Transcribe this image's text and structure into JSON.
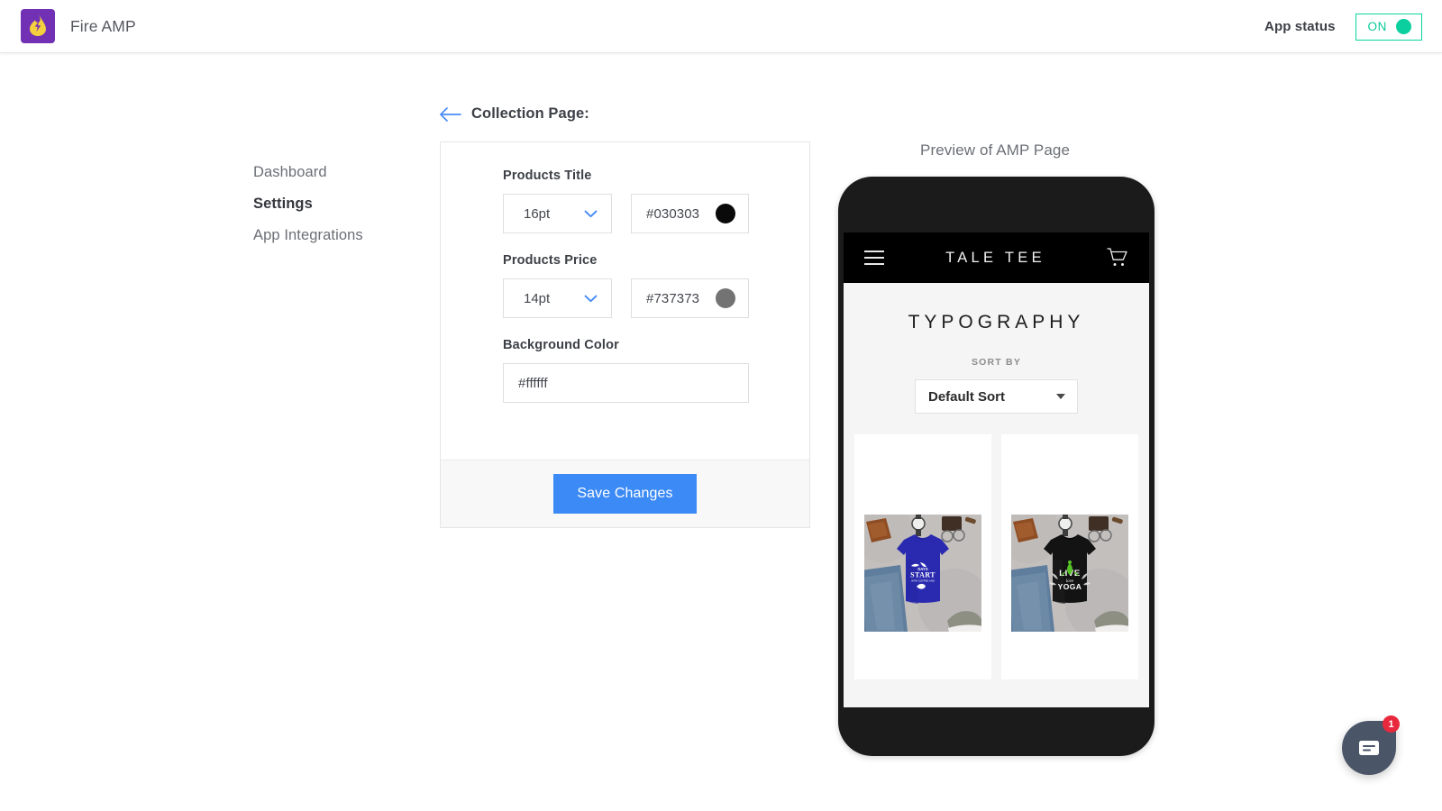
{
  "header": {
    "brand_name": "Fire AMP",
    "logo_icon": "flame-bolt-icon",
    "logo_bg": "#7230b4",
    "status_label": "App status",
    "toggle_state": "ON",
    "toggle_color": "#06d6a0"
  },
  "sidebar": {
    "items": [
      {
        "label": "Dashboard",
        "active": false
      },
      {
        "label": "Settings",
        "active": true
      },
      {
        "label": "App Integrations",
        "active": false
      }
    ]
  },
  "page": {
    "back_icon": "arrow-left-icon",
    "title": "Collection Page:"
  },
  "settings": {
    "fields": [
      {
        "label": "Products Title",
        "size_value": "16pt",
        "color_value": "#030303",
        "swatch_color": "#0a0a0a"
      },
      {
        "label": "Products Price",
        "size_value": "14pt",
        "color_value": "#737373",
        "swatch_color": "#737373"
      }
    ],
    "background_field": {
      "label": "Background Color",
      "value": "#ffffff"
    },
    "save_label": "Save Changes",
    "save_color": "#3c8af5"
  },
  "preview": {
    "label": "Preview of AMP Page",
    "shop": {
      "menu_icon": "hamburger-menu-icon",
      "store_name": "TALE TEE",
      "cart_icon": "shopping-cart-icon",
      "collection_title": "TYPOGRAPHY",
      "sort_label": "SORT BY",
      "sort_value": "Default Sort",
      "products": [
        {
          "name": "blue-typography-tee",
          "shirt_color": "#2a2ab0",
          "graphic": "good things START with Eat"
        },
        {
          "name": "black-yoga-tee",
          "shirt_color": "#131313",
          "graphic": "LIVE love YOGA"
        }
      ]
    }
  },
  "chat": {
    "icon": "chat-message-icon",
    "badge_count": "1",
    "bubble_color": "#4a5568",
    "badge_color": "#e8283c"
  }
}
